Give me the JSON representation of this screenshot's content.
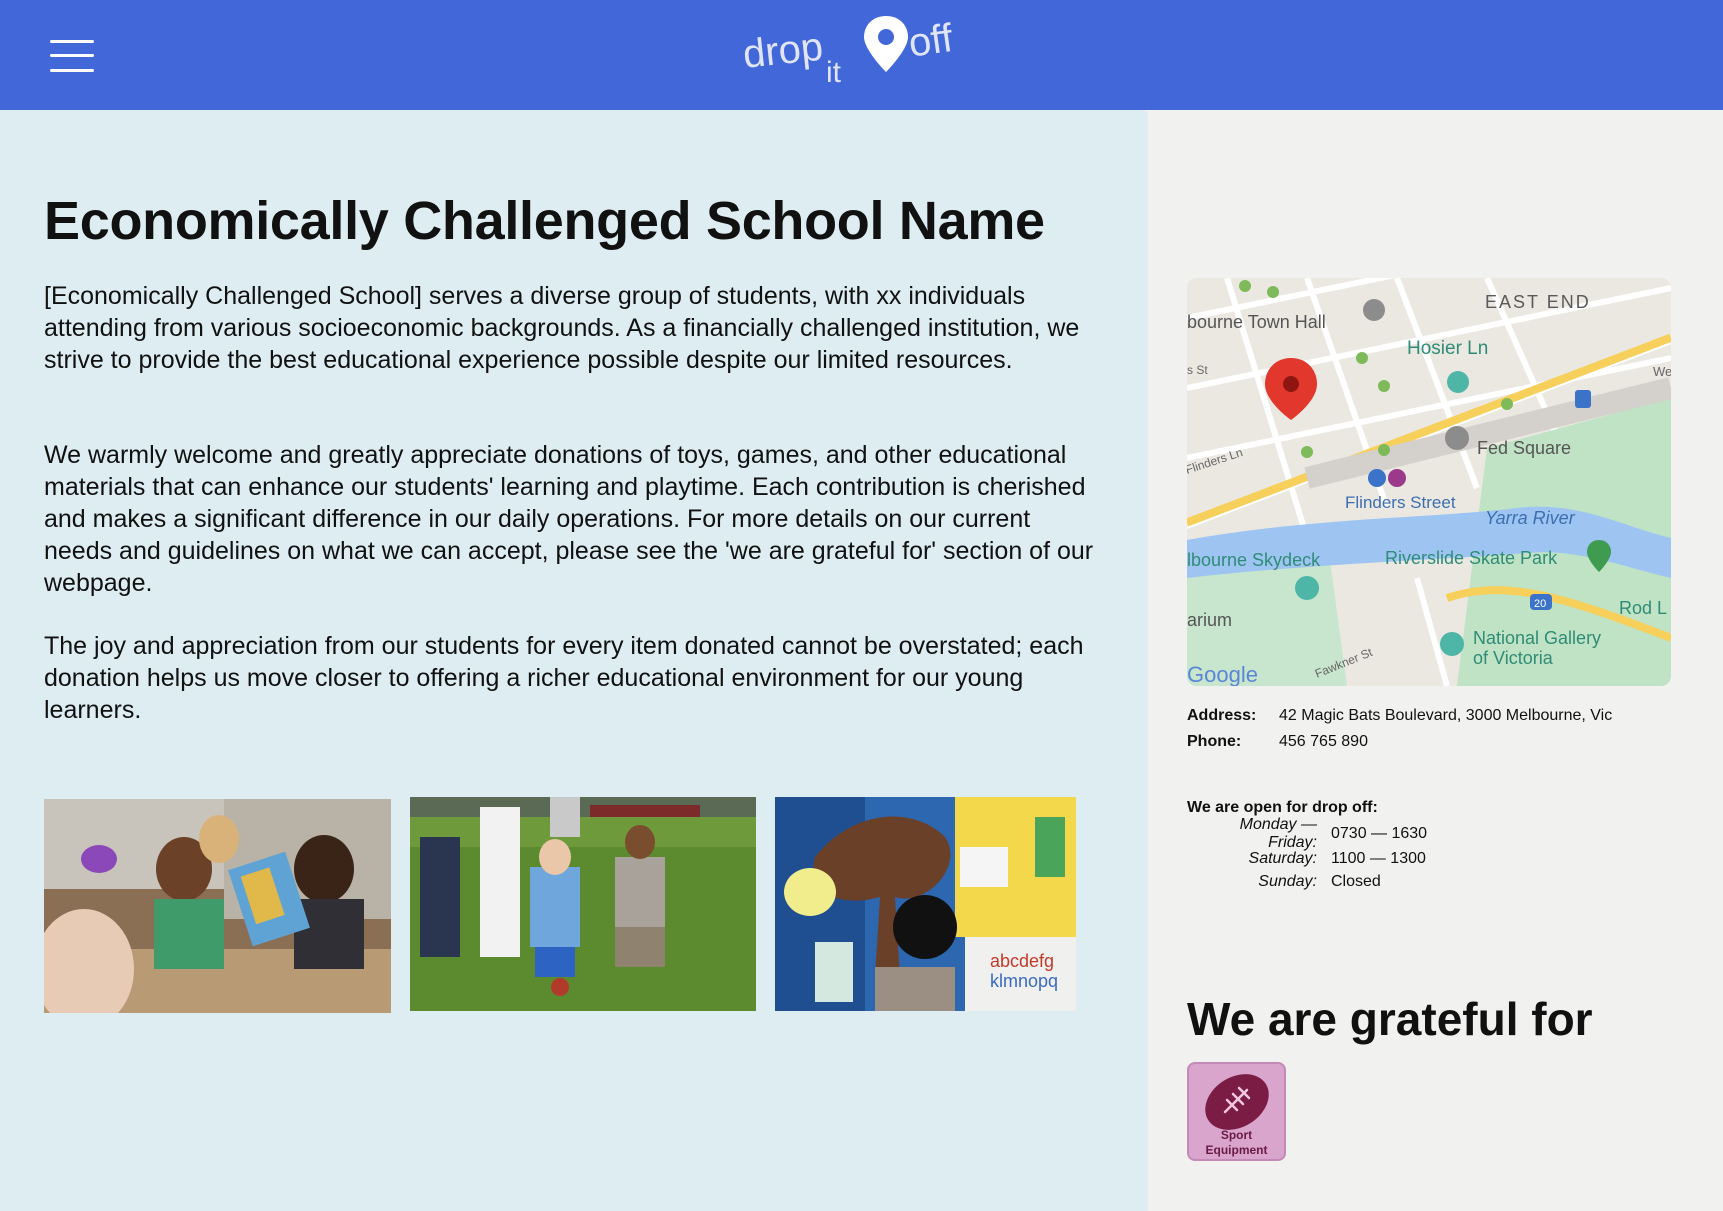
{
  "header": {
    "logo_text_part1": "drop",
    "logo_text_part2": "it",
    "logo_text_part3": "off",
    "bg_color": "#4267d9"
  },
  "main": {
    "title": "Economically Challenged School Name",
    "paragraphs": [
      "[Economically Challenged School] serves a diverse group of students, with xx individuals attending from various socioeconomic backgrounds. As a financially challenged institution, we strive to provide the best educational experience possible despite our limited resources.",
      "We warmly welcome and greatly appreciate donations of toys, games, and other educational materials that can enhance our students' learning and playtime. Each contribution is cherished and makes a significant difference in our daily operations. For more details on our current needs and guidelines on what we can accept, please see the 'we are grateful for' section of our webpage.",
      "The joy and appreciation from our students for every item donated cannot be overstated; each donation helps us move closer to offering a richer educational environment for our young learners."
    ]
  },
  "map": {
    "labels": [
      "EAST END",
      "bourne Town Hall",
      "Hosier Ln",
      "Fed Square",
      "Flinders Street",
      "Yarra River",
      "lbourne Skydeck",
      "Riverslide Skate Park",
      "arium",
      "National Gallery",
      "of Victoria",
      "Rod L",
      "Flinders Ln",
      "Fawkner St",
      "s St",
      "We",
      "20"
    ]
  },
  "contact": {
    "address_label": "Address:",
    "address_value": "42 Magic Bats Boulevard, 3000 Melbourne, Vic",
    "phone_label": "Phone:",
    "phone_value": "456 765 890"
  },
  "hours": {
    "title": "We are open for drop off:",
    "rows": [
      {
        "day": "Monday — Friday:",
        "time": "0730 — 1630"
      },
      {
        "day": "Saturday:",
        "time": "1100 — 1300"
      },
      {
        "day": "Sunday:",
        "time": "Closed"
      }
    ]
  },
  "grateful": {
    "title": "We are grateful for",
    "items": [
      {
        "label_line1": "Sport",
        "label_line2": "Equipment",
        "icon": "football-icon"
      }
    ]
  }
}
